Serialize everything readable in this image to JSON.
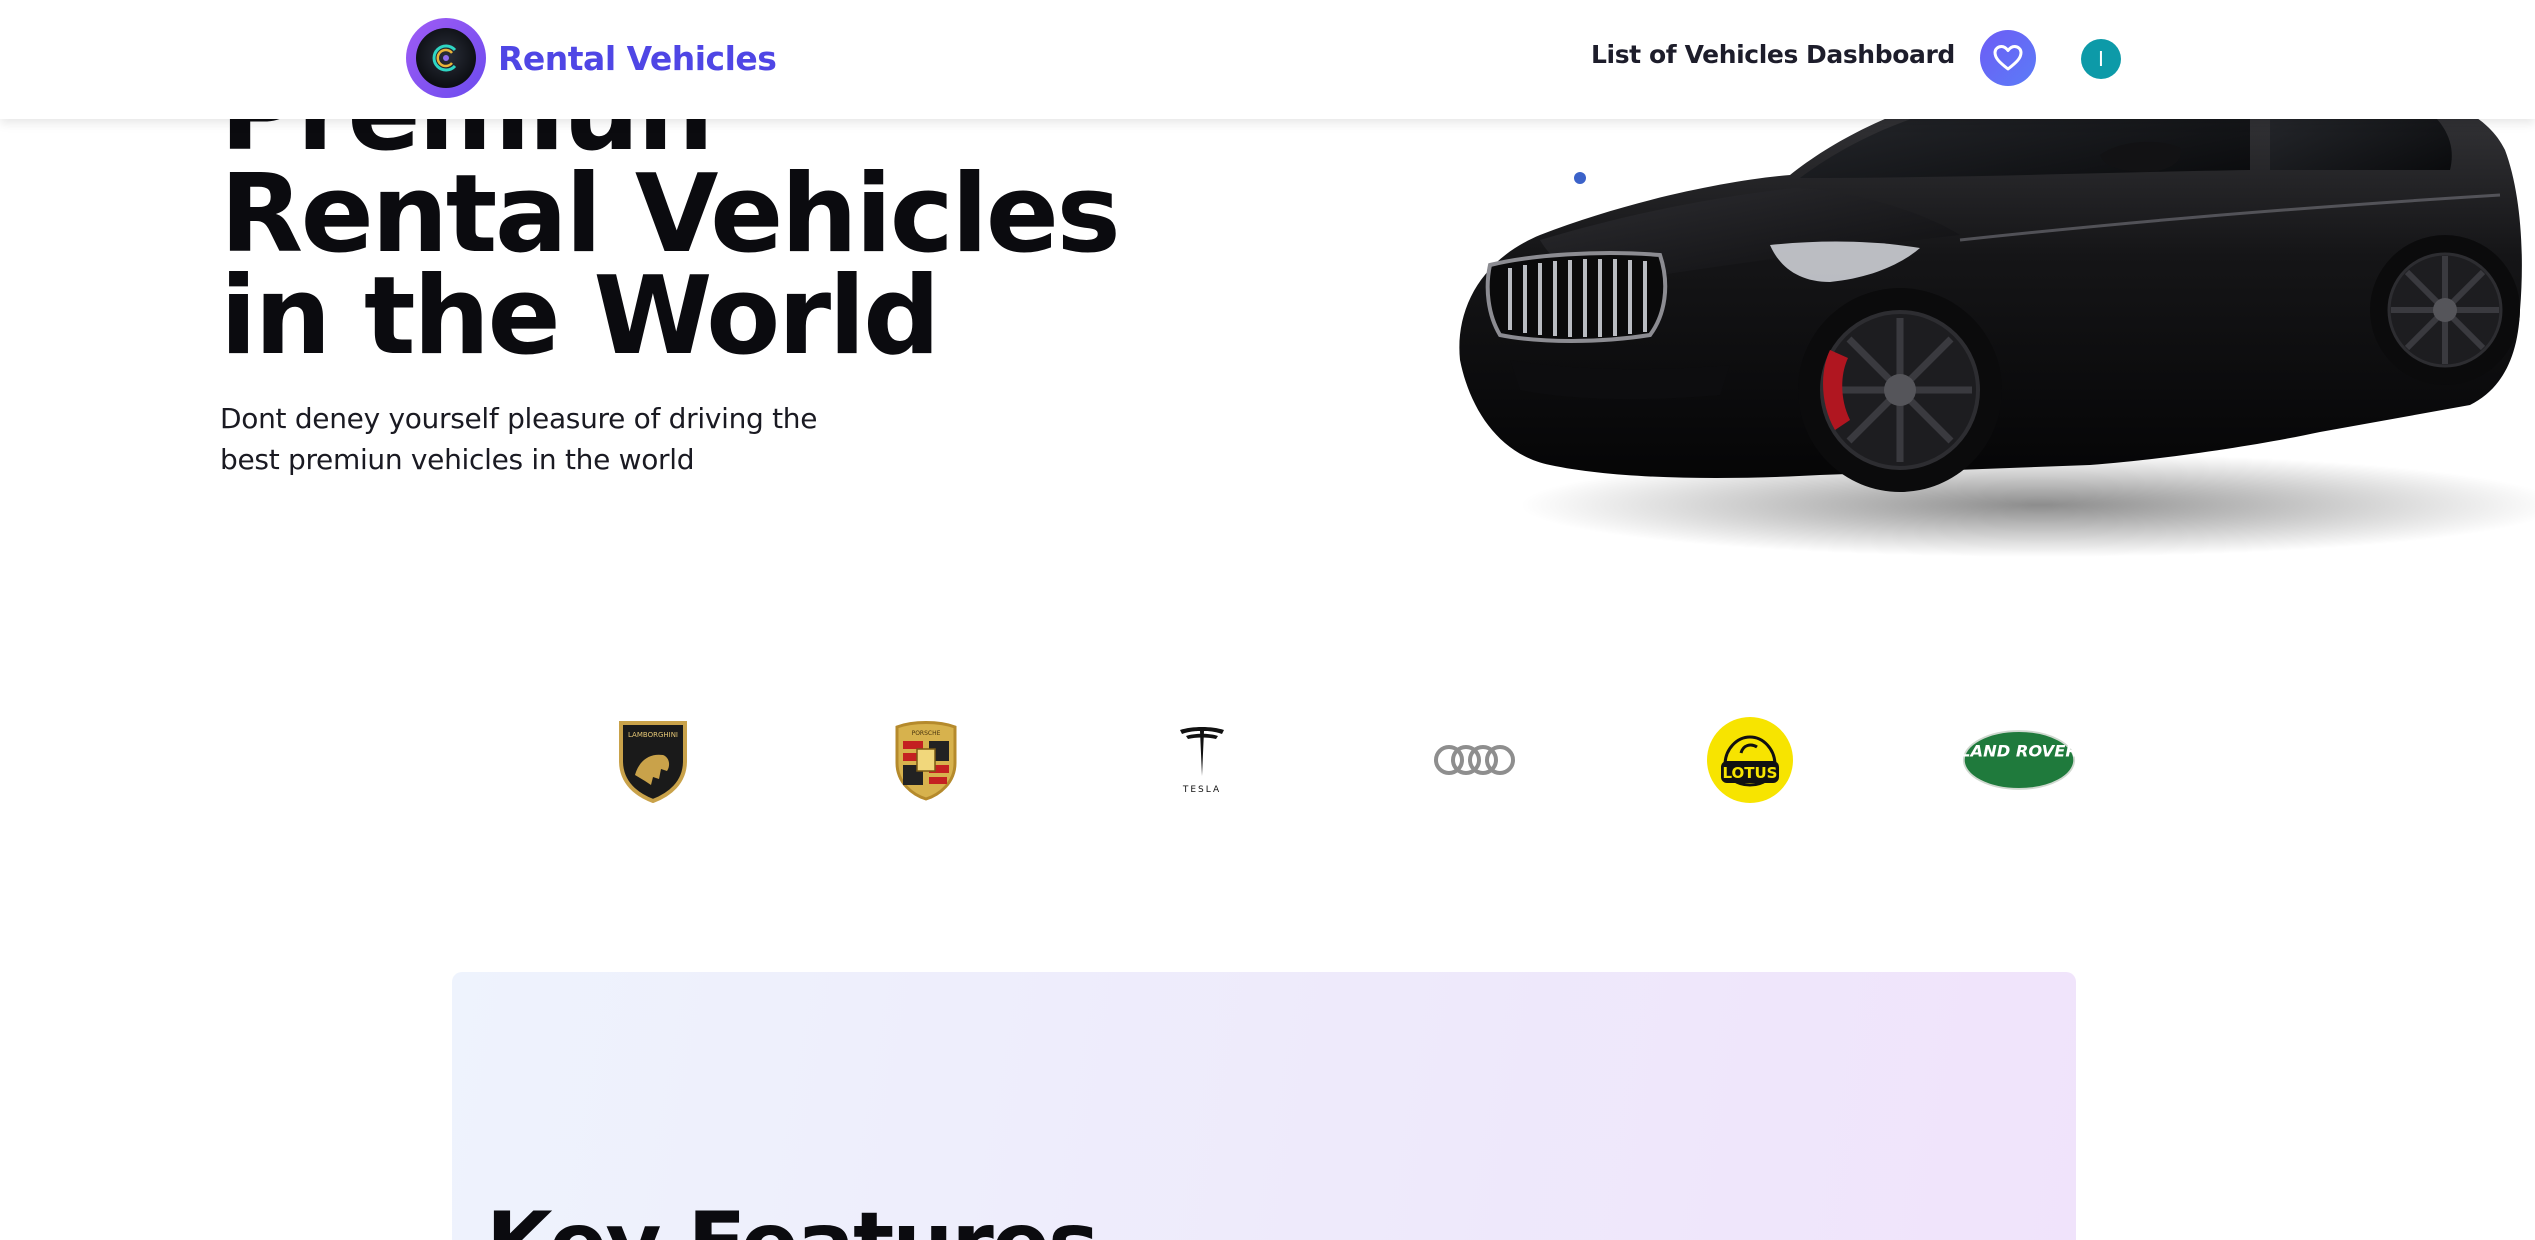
{
  "header": {
    "brand_name": "Rental Vehicles",
    "nav": {
      "vehicles": "List of Vehicles",
      "dashboard": "Dashboard"
    },
    "avatar_initial": "I",
    "accent_color": "#4f46e5"
  },
  "hero": {
    "title_lines": [
      "Premiun",
      "Rental Vehicles",
      "in the World"
    ],
    "subtitle_lines": [
      "Dont deney yourself pleasure of driving the",
      "best premiun vehicles in the world"
    ]
  },
  "brands": {
    "logos": [
      {
        "icon": "lamborghini-logo-icon",
        "label": "LAMBORGHINI"
      },
      {
        "icon": "porsche-logo-icon",
        "label": "PORSCHE"
      },
      {
        "icon": "tesla-logo-icon",
        "label": "TESLA"
      },
      {
        "icon": "audi-logo-icon"
      },
      {
        "icon": "lotus-logo-icon",
        "label": "LOTUS"
      },
      {
        "icon": "land-rover-logo-icon",
        "label": "LAND ROVER"
      }
    ]
  },
  "features": {
    "title": "Key Features"
  }
}
